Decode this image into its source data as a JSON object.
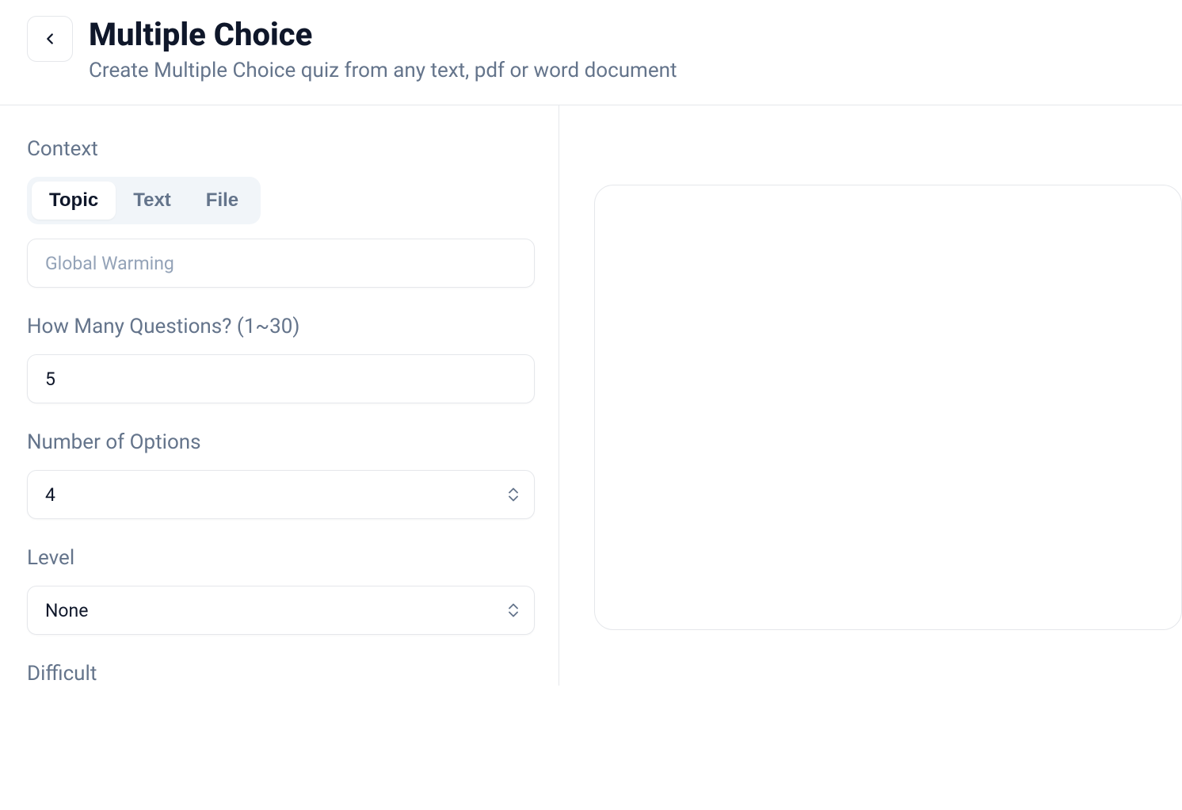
{
  "header": {
    "title": "Multiple Choice",
    "subtitle": "Create Multiple Choice quiz from any text, pdf or word document"
  },
  "form": {
    "context": {
      "label": "Context",
      "tabs": {
        "topic": "Topic",
        "text": "Text",
        "file": "File"
      },
      "active_tab": "topic",
      "topic_placeholder": "Global Warming",
      "topic_value": ""
    },
    "questions": {
      "label": "How Many Questions? (1~30)",
      "value": "5"
    },
    "options": {
      "label": "Number of Options",
      "value": "4"
    },
    "level": {
      "label": "Level",
      "value": "None"
    },
    "difficult": {
      "label": "Difficult"
    }
  }
}
